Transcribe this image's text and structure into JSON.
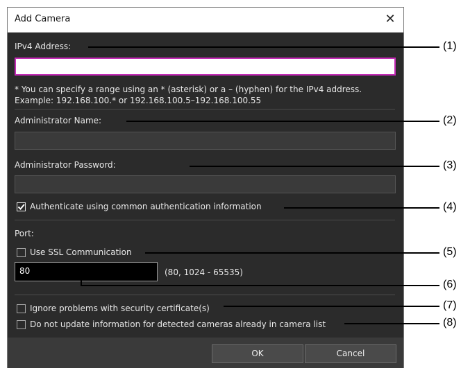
{
  "dialog": {
    "title": "Add Camera",
    "close_glyph": "✕",
    "ipv4": {
      "label": "IPv4 Address:",
      "value": "",
      "note_line1": "* You can specify a range using an * (asterisk) or a – (hyphen) for the IPv4 address.",
      "note_line2": "Example: 192.168.100.* or 192.168.100.5–192.168.100.55"
    },
    "admin_name": {
      "label": "Administrator Name:",
      "value": ""
    },
    "admin_password": {
      "label": "Administrator Password:",
      "value": ""
    },
    "auth_common": {
      "label": "Authenticate using common authentication information",
      "checked": true
    },
    "port": {
      "label": "Port:",
      "ssl_label": "Use SSL Communication",
      "ssl_checked": false,
      "value": "80",
      "range_hint": "(80, 1024 - 65535)"
    },
    "ignore_cert": {
      "label": "Ignore problems with security certificate(s)",
      "checked": false
    },
    "no_update": {
      "label": "Do not update information for detected cameras already in camera list",
      "checked": false
    },
    "buttons": {
      "ok": "OK",
      "cancel": "Cancel"
    }
  },
  "callouts": [
    "(1)",
    "(2)",
    "(3)",
    "(4)",
    "(5)",
    "(6)",
    "(7)",
    "(8)"
  ],
  "colors": {
    "dialog_bg": "#2b2b2b",
    "active_border": "#c42bb6",
    "footer_bg": "#3a3a3a"
  }
}
